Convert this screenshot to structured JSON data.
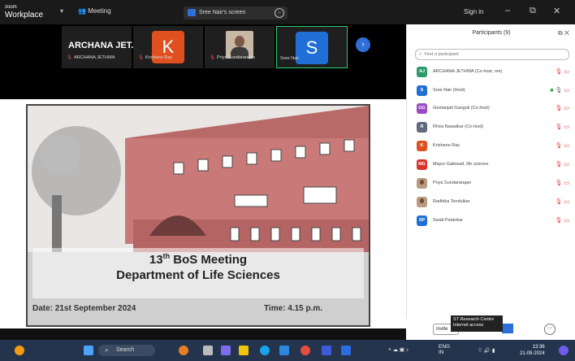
{
  "app": {
    "logo_top": "zoom",
    "logo_bottom": "Workplace",
    "dropdown": "▾",
    "meeting_label": "Meeting",
    "share_label": "Sree Nair's screen",
    "signin": "Sign in"
  },
  "window_buttons": [
    "–",
    "⧉",
    "✕"
  ],
  "strip": {
    "big_name": "ARCHANA JET...",
    "tiles": [
      {
        "label": "ARCHANA JETHWA"
      },
      {
        "avatar": "K",
        "label": "Krishanu Ray",
        "color": "#e0501e"
      },
      {
        "label": "Priya Sundararajan"
      },
      {
        "avatar": "S",
        "label": "Sree Nair",
        "color": "#1f6fd6"
      }
    ],
    "next": "›"
  },
  "poster": {
    "title_prefix": "13",
    "title_sup": "th",
    "title_suffix": " BoS Meeting",
    "subtitle": "Department of Life Sciences",
    "below_left": "Date: 21st September 2024",
    "below_right": "Time: 4.15 p.m."
  },
  "panel": {
    "title": "Participants (9)",
    "icons": "⧉ ✕",
    "search_placeholder": "Find a participant",
    "participants": [
      {
        "initials": "AJ",
        "name": "ARCHANA JETHWA (Co-host, me)",
        "color": "#2e9a6a"
      },
      {
        "initials": "S",
        "name": "Sree Nair (Host)",
        "color": "#1f6fd6",
        "host": true
      },
      {
        "initials": "GG",
        "name": "Geetanjali Ganguli (Co-host)",
        "color": "#9b4bc2"
      },
      {
        "initials": "R",
        "name": "Rhea Nawalkar (Co-host)",
        "color": "#5f6b7a"
      },
      {
        "initials": "K",
        "name": "Krishanu Ray",
        "color": "#e0501e"
      },
      {
        "initials": "MG",
        "name": "Mayur Gaikwad, life science",
        "color": "#d9342b"
      },
      {
        "initials": "",
        "name": "Priya Sundararajan",
        "photo": true
      },
      {
        "initials": "",
        "name": "Radhika Tendulkar",
        "photo": true
      },
      {
        "initials": "SP",
        "name": "Swati Patankar",
        "color": "#1f6fd6"
      }
    ]
  },
  "footer": {
    "invite": "Invite",
    "tooltip_l1": "ST Research Centre",
    "tooltip_l2": "Internet access",
    "more": "···"
  },
  "taskbar": {
    "search": "Search",
    "lang_l1": "ENG",
    "lang_l2": "IN",
    "time": "13:36",
    "date": "21-09-2024"
  },
  "colors": {
    "accent": "#2f6fd8",
    "mic_off": "#e33",
    "taskbar": "#24344d"
  }
}
